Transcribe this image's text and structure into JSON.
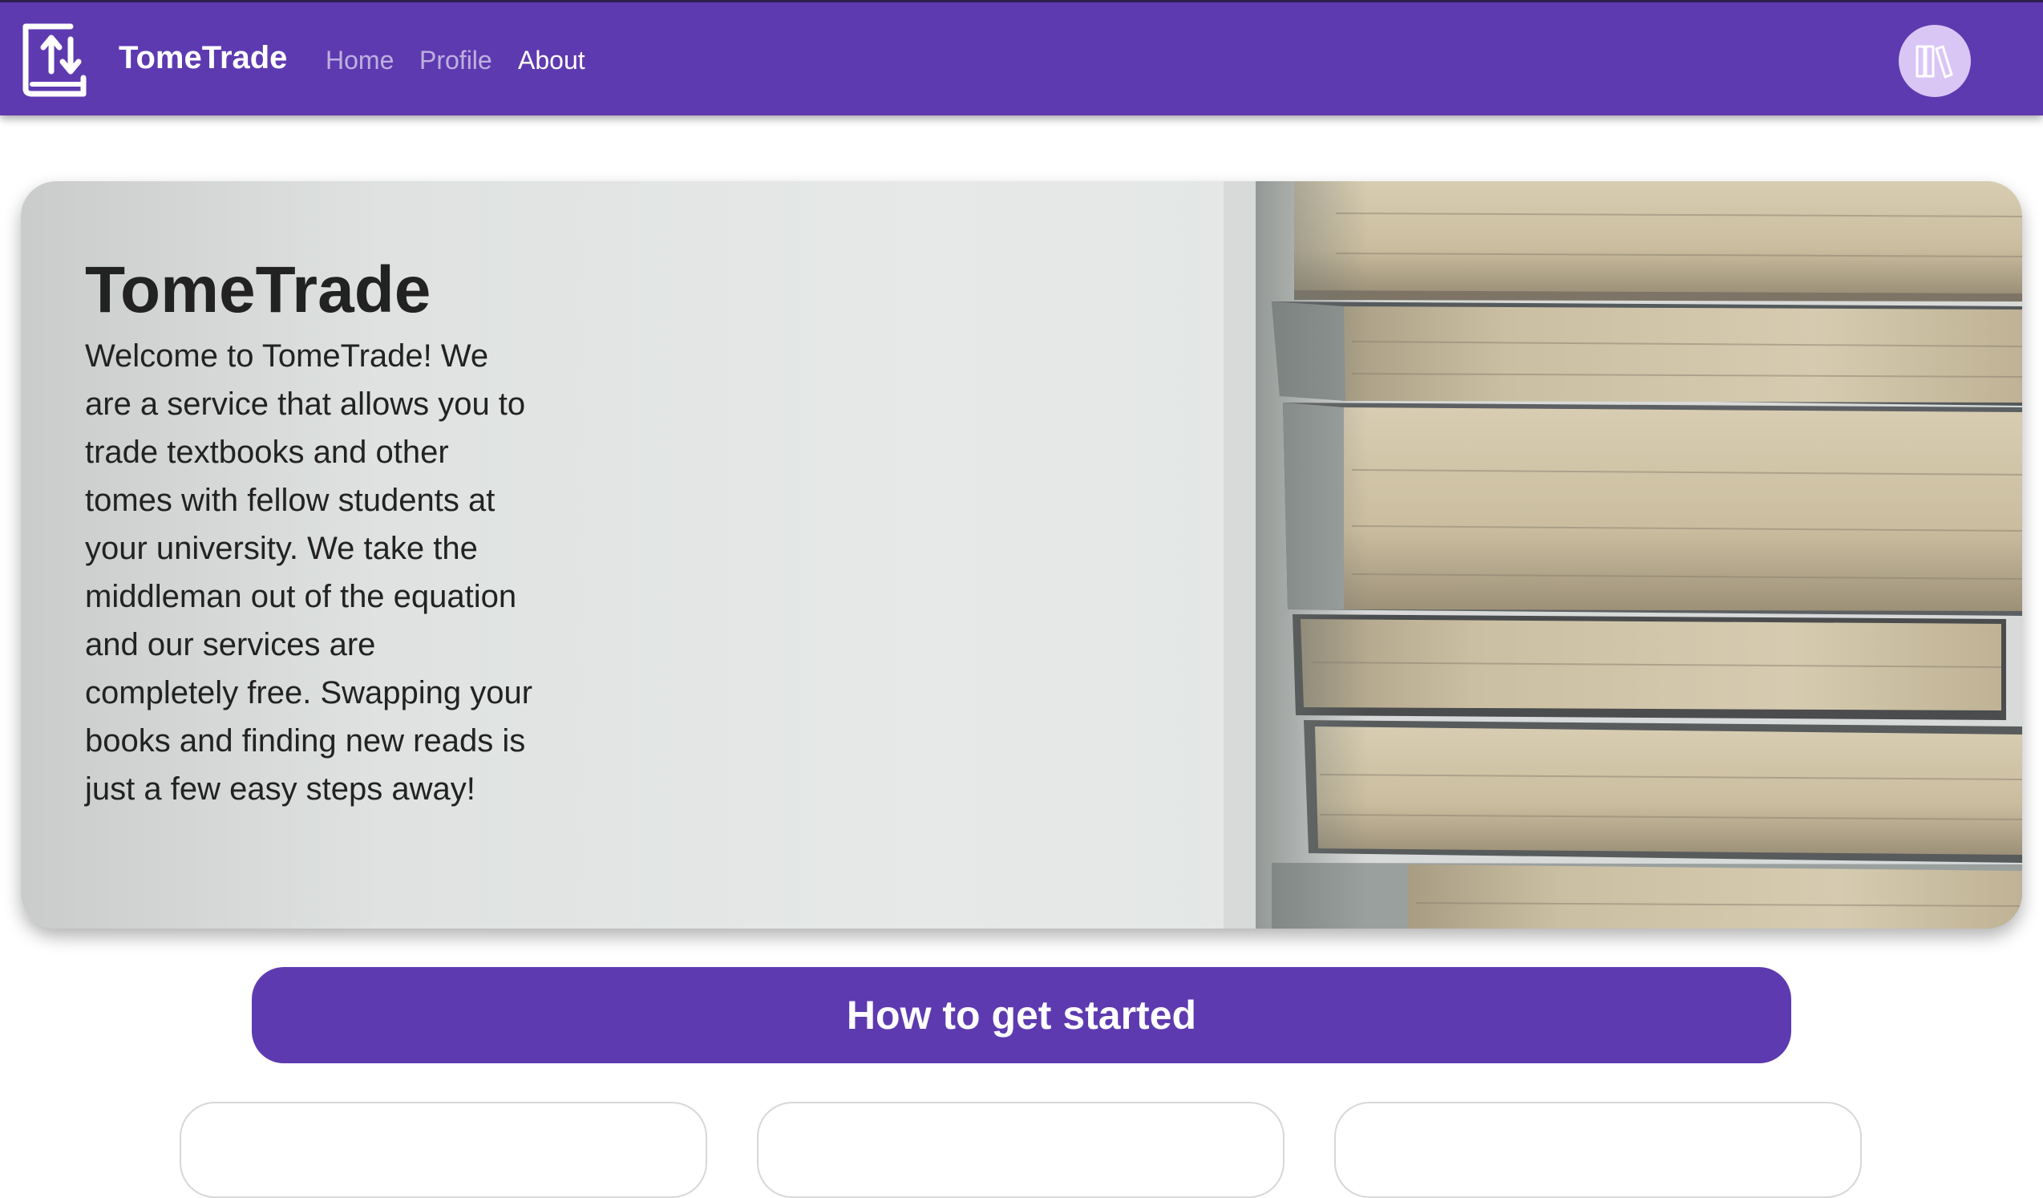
{
  "header": {
    "brand": "TomeTrade",
    "nav": [
      {
        "label": "Home",
        "active": false
      },
      {
        "label": "Profile",
        "active": false
      },
      {
        "label": "About",
        "active": true
      }
    ],
    "logo_icon": "book-swap-icon",
    "avatar_icon": "library-icon"
  },
  "hero": {
    "title": "TomeTrade",
    "text": "Welcome to TomeTrade! We are a service that allows you to trade textbooks and other tomes with fellow students at your university. We take the middleman out of the equation and our services are completely free. Swapping your books and finding new reads is just a few easy steps away!",
    "image": "stack-of-books"
  },
  "cta": {
    "label": "How to get started"
  },
  "colors": {
    "brand_purple": "#5e3ab0",
    "avatar_bg": "#d9c6f5"
  }
}
